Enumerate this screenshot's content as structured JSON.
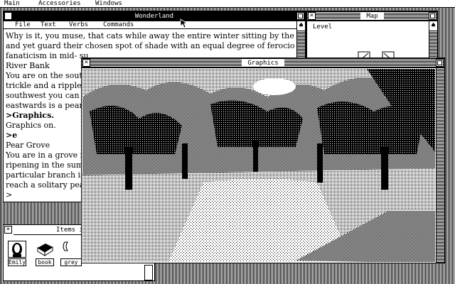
{
  "menubar": {
    "items": [
      "Main",
      "Accessories",
      "Windows"
    ]
  },
  "wonderland": {
    "title": "Wonderland",
    "menu": [
      "File",
      "Text",
      "Verbs",
      "Commands"
    ],
    "lines": [
      {
        "text": "Why is it, you muse, that cats while away the entire winter sitting by the fire",
        "cmd": false
      },
      {
        "text": "and yet guard their chosen spot of shade with an equal degree of ferocious",
        "cmd": false
      },
      {
        "text": "fanaticism in mid- su",
        "cmd": false
      },
      {
        "text": "River Bank",
        "cmd": false
      },
      {
        "text": "You are on the south",
        "cmd": false
      },
      {
        "text": "trickle and a ripple so",
        "cmd": false
      },
      {
        "text": "southwest you can ju",
        "cmd": false
      },
      {
        "text": "eastwards is a pear g",
        "cmd": false
      },
      {
        "text": ">Graphics.",
        "cmd": true
      },
      {
        "text": "Graphics on.",
        "cmd": false
      },
      {
        "text": ">e",
        "cmd": true
      },
      {
        "text": "Pear Grove",
        "cmd": false
      },
      {
        "text": "You are in a grove fu",
        "cmd": false
      },
      {
        "text": "ripening in the summ",
        "cmd": false
      },
      {
        "text": "particular branch is s",
        "cmd": false
      },
      {
        "text": "reach a solitary pear",
        "cmd": false
      },
      {
        "text": ">",
        "cmd": false
      }
    ]
  },
  "map": {
    "title": "Map",
    "level_label": "Level"
  },
  "graphics": {
    "title": "Graphics"
  },
  "items": {
    "title": "Items i",
    "list": [
      {
        "label": "Emily",
        "icon": "girl-portrait-icon"
      },
      {
        "label": "book",
        "icon": "book-icon"
      },
      {
        "label": "grey",
        "icon": "grey-item-icon"
      }
    ]
  },
  "colors": {
    "foreground": "#000000",
    "background": "#ffffff"
  }
}
